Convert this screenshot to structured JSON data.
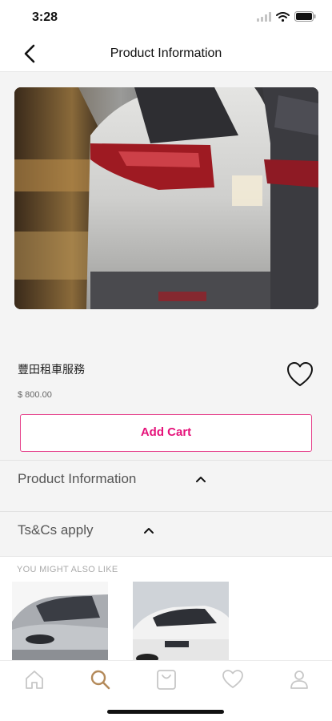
{
  "status_bar": {
    "time": "3:28"
  },
  "nav": {
    "title": "Product Information"
  },
  "product": {
    "name": "豐田租車服務",
    "price": "$ 800.00",
    "add_cart_label": "Add Cart"
  },
  "sections": [
    {
      "label": "Product Information"
    },
    {
      "label": "Ts&Cs apply"
    }
  ],
  "recommendations": {
    "title": "YOU MIGHT ALSO LIKE"
  },
  "tabs": [
    {
      "icon": "home-icon"
    },
    {
      "icon": "search-icon"
    },
    {
      "icon": "bag-icon"
    },
    {
      "icon": "heart-icon"
    },
    {
      "icon": "user-icon"
    }
  ],
  "colors": {
    "accent": "#e5127a",
    "active_tab": "#b48a5a",
    "inactive_tab": "#c7c7c7"
  }
}
